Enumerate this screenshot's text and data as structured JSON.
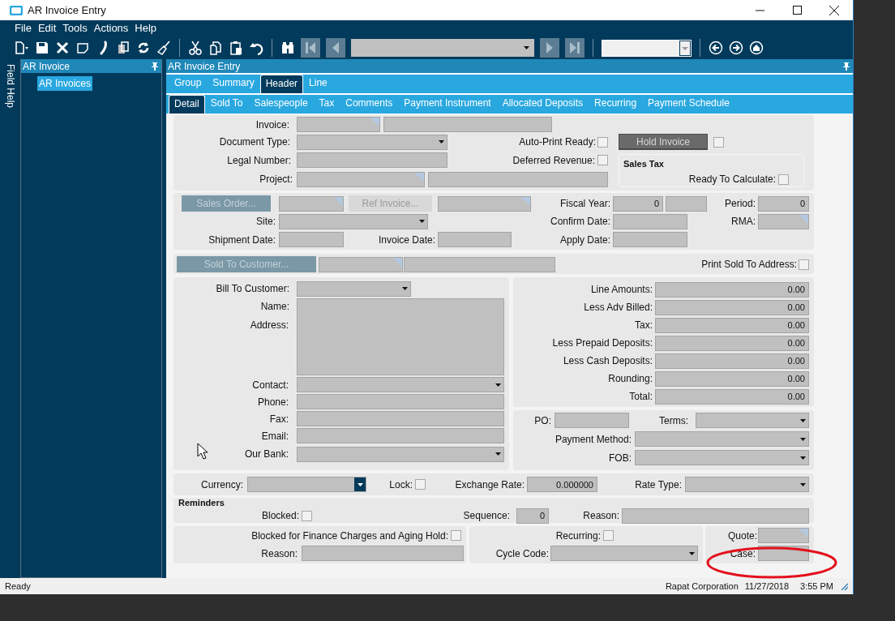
{
  "window": {
    "title": "AR Invoice Entry"
  },
  "menu": [
    "File",
    "Edit",
    "Tools",
    "Actions",
    "Help"
  ],
  "sidebar": {
    "vertical_tab": "Field Help",
    "title": "AR Invoice",
    "items": [
      {
        "label": "AR Invoices",
        "selected": true
      }
    ]
  },
  "main": {
    "title": "AR Invoice Entry",
    "tabs": [
      {
        "label": "Group",
        "selected": false
      },
      {
        "label": "Summary",
        "selected": false
      },
      {
        "label": "Header",
        "selected": true
      },
      {
        "label": "Line",
        "selected": false
      }
    ],
    "subtabs": [
      {
        "label": "Detail",
        "selected": true
      },
      {
        "label": "Sold To",
        "selected": false
      },
      {
        "label": "Salespeople",
        "selected": false
      },
      {
        "label": "Tax",
        "selected": false
      },
      {
        "label": "Comments",
        "selected": false
      },
      {
        "label": "Payment Instrument",
        "selected": false
      },
      {
        "label": "Allocated Deposits",
        "selected": false
      },
      {
        "label": "Recurring",
        "selected": false
      },
      {
        "label": "Payment Schedule",
        "selected": false
      }
    ]
  },
  "form": {
    "panels": [
      {
        "items": [
          {
            "kind": "label",
            "text": "Invoice:"
          },
          {
            "kind": "input",
            "lookup": true
          },
          {
            "kind": "input",
            "lookup": false
          },
          {
            "kind": "label",
            "text": "Document Type:"
          },
          {
            "kind": "select",
            "focused": false
          },
          {
            "kind": "label",
            "text": "Auto-Print Ready:"
          },
          {
            "kind": "checkbox",
            "checked": false
          },
          {
            "kind": "button",
            "label": "Hold Invoice"
          },
          {
            "kind": "checkbox",
            "checked": false
          },
          {
            "kind": "label",
            "text": "Legal Number:"
          },
          {
            "kind": "input",
            "lookup": false
          },
          {
            "kind": "label",
            "text": "Deferred Revenue:"
          },
          {
            "kind": "checkbox",
            "checked": false
          },
          {
            "kind": "group",
            "title": "Sales Tax"
          },
          {
            "kind": "label",
            "text": "Project:"
          },
          {
            "kind": "input",
            "lookup": true
          },
          {
            "kind": "input",
            "lookup": false
          },
          {
            "kind": "label",
            "text": "Ready To Calculate:"
          },
          {
            "kind": "checkbox",
            "checked": false
          }
        ]
      },
      {
        "items": [
          {
            "kind": "button",
            "label": "Sales Order..."
          },
          {
            "kind": "input",
            "lookup": true
          },
          {
            "kind": "button",
            "label": "Ref Invoice..."
          },
          {
            "kind": "input",
            "lookup": true
          },
          {
            "kind": "label",
            "text": "Fiscal Year:"
          },
          {
            "kind": "input",
            "value": "0",
            "lookup": false
          },
          {
            "kind": "input",
            "lookup": false
          },
          {
            "kind": "label",
            "text": "Period:"
          },
          {
            "kind": "input",
            "value": "0",
            "lookup": false
          },
          {
            "kind": "label",
            "text": "Site:"
          },
          {
            "kind": "select",
            "focused": false
          },
          {
            "kind": "label",
            "text": "Confirm Date:"
          },
          {
            "kind": "input",
            "lookup": false
          },
          {
            "kind": "label",
            "text": "RMA:"
          },
          {
            "kind": "input",
            "lookup": true
          },
          {
            "kind": "label",
            "text": "Shipment Date:"
          },
          {
            "kind": "input",
            "lookup": false
          },
          {
            "kind": "label",
            "text": "Invoice Date:"
          },
          {
            "kind": "input",
            "lookup": false
          },
          {
            "kind": "label",
            "text": "Apply Date:"
          },
          {
            "kind": "input",
            "lookup": false
          }
        ]
      },
      {
        "items": [
          {
            "kind": "button",
            "label": "Sold To Customer..."
          },
          {
            "kind": "input",
            "lookup": true
          },
          {
            "kind": "input",
            "lookup": false
          },
          {
            "kind": "label",
            "text": "Print Sold To Address:"
          },
          {
            "kind": "checkbox",
            "checked": false
          }
        ]
      },
      {
        "items": [
          {
            "kind": "label",
            "text": "Bill To Customer:"
          },
          {
            "kind": "select",
            "focused": false
          },
          {
            "kind": "label",
            "text": "Name:"
          },
          {
            "kind": "label",
            "text": "Address:"
          },
          {
            "kind": "textarea"
          },
          {
            "kind": "label",
            "text": "Contact:"
          },
          {
            "kind": "select",
            "focused": false
          },
          {
            "kind": "label",
            "text": "Phone:"
          },
          {
            "kind": "input",
            "lookup": false
          },
          {
            "kind": "label",
            "text": "Fax:"
          },
          {
            "kind": "input",
            "lookup": false
          },
          {
            "kind": "label",
            "text": "Email:"
          },
          {
            "kind": "input",
            "lookup": false
          },
          {
            "kind": "label",
            "text": "Our Bank:"
          },
          {
            "kind": "select",
            "focused": false
          }
        ]
      },
      {
        "items": [
          {
            "kind": "label",
            "text": "Line Amounts:"
          },
          {
            "kind": "input",
            "value": "0.00",
            "lookup": false
          },
          {
            "kind": "label",
            "text": "Less Adv Billed:"
          },
          {
            "kind": "input",
            "value": "0.00",
            "lookup": false
          },
          {
            "kind": "label",
            "text": "Tax:"
          },
          {
            "kind": "input",
            "value": "0.00",
            "lookup": false
          },
          {
            "kind": "label",
            "text": "Less Prepaid Deposits:"
          },
          {
            "kind": "input",
            "value": "0.00",
            "lookup": false
          },
          {
            "kind": "label",
            "text": "Less Cash Deposits:"
          },
          {
            "kind": "input",
            "value": "0.00",
            "lookup": false
          },
          {
            "kind": "label",
            "text": "Rounding:"
          },
          {
            "kind": "input",
            "value": "0.00",
            "lookup": false
          },
          {
            "kind": "label",
            "text": "Total:"
          },
          {
            "kind": "input",
            "value": "0.00",
            "lookup": false
          }
        ]
      },
      {
        "items": [
          {
            "kind": "label",
            "text": "PO:"
          },
          {
            "kind": "input",
            "lookup": false
          },
          {
            "kind": "label",
            "text": "Terms:"
          },
          {
            "kind": "select",
            "focused": false
          },
          {
            "kind": "label",
            "text": "Payment Method:"
          },
          {
            "kind": "select",
            "focused": false
          },
          {
            "kind": "label",
            "text": "FOB:"
          },
          {
            "kind": "select",
            "focused": false
          }
        ]
      },
      {
        "items": [
          {
            "kind": "label",
            "text": "Currency:"
          },
          {
            "kind": "select",
            "focused": true
          },
          {
            "kind": "label",
            "text": "Lock:"
          },
          {
            "kind": "checkbox",
            "checked": false
          },
          {
            "kind": "label",
            "text": "Exchange Rate:"
          },
          {
            "kind": "input",
            "value": "0.000000",
            "lookup": false
          },
          {
            "kind": "label",
            "text": "Rate Type:"
          },
          {
            "kind": "select",
            "focused": false
          }
        ]
      },
      {
        "items": [
          {
            "kind": "heading",
            "text": "Reminders"
          },
          {
            "kind": "label",
            "text": "Blocked:"
          },
          {
            "kind": "checkbox",
            "checked": false
          },
          {
            "kind": "label",
            "text": "Sequence:"
          },
          {
            "kind": "input",
            "value": "0",
            "lookup": false
          },
          {
            "kind": "label",
            "text": "Reason:"
          },
          {
            "kind": "input",
            "lookup": false
          }
        ]
      },
      {
        "items": [
          {
            "kind": "label",
            "text": "Blocked for Finance Charges and Aging Hold:"
          },
          {
            "kind": "checkbox",
            "checked": false
          },
          {
            "kind": "label",
            "text": "Reason:"
          },
          {
            "kind": "input",
            "lookup": false
          }
        ]
      },
      {
        "items": [
          {
            "kind": "label",
            "text": "Recurring:"
          },
          {
            "kind": "checkbox",
            "checked": false
          },
          {
            "kind": "label",
            "text": "Cycle Code:"
          },
          {
            "kind": "select",
            "focused": false
          }
        ]
      },
      {
        "items": [
          {
            "kind": "label",
            "text": "Quote:"
          },
          {
            "kind": "input",
            "lookup": true
          },
          {
            "kind": "label",
            "text": "Case:"
          },
          {
            "kind": "input",
            "lookup": false
          }
        ]
      }
    ]
  },
  "status_bar": {
    "message": "Ready",
    "company": "Rapat Corporation",
    "date": "11/27/2018",
    "time": "3:55 PM"
  }
}
